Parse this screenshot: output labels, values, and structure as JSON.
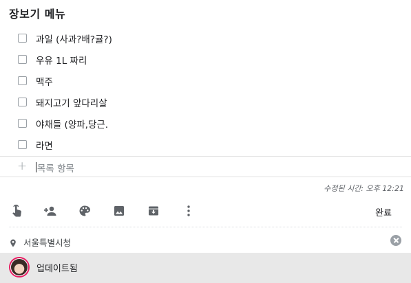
{
  "note": {
    "title": "장보기 메뉴",
    "items": [
      {
        "label": "과일 (사과?배?귤?)",
        "checked": false
      },
      {
        "label": "우유 1L 짜리",
        "checked": false
      },
      {
        "label": "맥주",
        "checked": false
      },
      {
        "label": "돼지고기 앞다리살",
        "checked": false
      },
      {
        "label": "야채들 (양파,당근.",
        "checked": false
      },
      {
        "label": "라면",
        "checked": false
      }
    ],
    "new_item_placeholder": "목록 항목",
    "edited_text": "수정된 시간: 오후 12:21"
  },
  "toolbar": {
    "icons": [
      "reminder-hand-icon",
      "add-collaborator-icon",
      "palette-icon",
      "image-icon",
      "archive-icon",
      "more-vert-icon"
    ],
    "done_label": "완료"
  },
  "location": {
    "text": "서울특별시청"
  },
  "footer": {
    "text": "업데이트됨"
  },
  "colors": {
    "footer_bg": "#e8e8e8",
    "avatar_ring": "#e91e63",
    "icon_gray": "#5f6368"
  }
}
